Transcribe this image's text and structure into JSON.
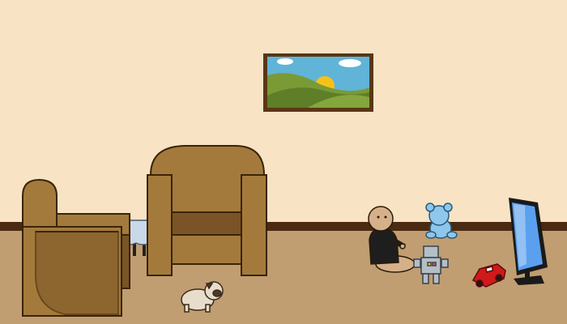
{
  "scene": {
    "colors": {
      "wall": "#f8e4c4",
      "baseboard": "#4a2a12",
      "floor": "#c09e72",
      "armchair": "#a47a3c",
      "armchair_dark": "#7a5426",
      "frame": "#5a3616",
      "sky": "#5fb4d8",
      "hills": "#7a9a36",
      "sun": "#f6c21a",
      "tablecloth": "#c9d9ea",
      "tv_screen": "#5aa0ee",
      "car": "#d01a1a",
      "robot": "#b4bec6",
      "bear": "#8ec6ec"
    },
    "objects": [
      {
        "name": "wall-painting"
      },
      {
        "name": "armchair-left"
      },
      {
        "name": "armchair-right"
      },
      {
        "name": "side-table"
      },
      {
        "name": "pug-dog"
      },
      {
        "name": "baby-character"
      },
      {
        "name": "toy-robot"
      },
      {
        "name": "teddy-bear"
      },
      {
        "name": "toy-car"
      },
      {
        "name": "television"
      }
    ]
  }
}
